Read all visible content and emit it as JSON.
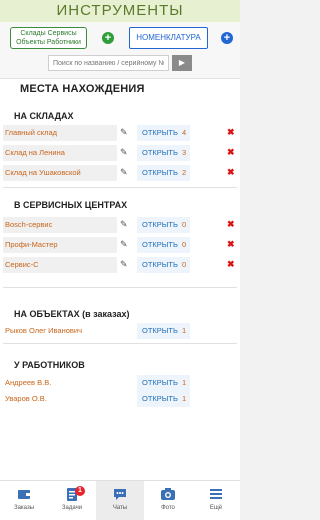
{
  "app": {
    "title": "ИНСТРУМЕНТЫ"
  },
  "toolbar": {
    "warehouses_button": [
      "Склады Сервисы",
      "Объекты Работники"
    ],
    "nomenclature_button": "НОМЕНКЛАТУРА",
    "search_placeholder": "Поиск по названию / серийному №"
  },
  "main": {
    "title": "МЕСТА НАХОЖДЕНИЯ",
    "open_label": "ОТКРЫТЬ",
    "sections": [
      {
        "title": "НА СКЛАДАХ",
        "items": [
          {
            "name": "Главный склад",
            "count": "4"
          },
          {
            "name": "Склад на Ленина",
            "count": "3"
          },
          {
            "name": "Склад на Ушаковской",
            "count": "2"
          }
        ]
      },
      {
        "title": "В СЕРВИСНЫХ ЦЕНТРАХ",
        "items": [
          {
            "name": "Bosch-сервис",
            "count": "0"
          },
          {
            "name": "Профи-Мастер",
            "count": "0"
          },
          {
            "name": "Сервис-С",
            "count": "0"
          }
        ]
      },
      {
        "title": "НА ОБЪЕКТАХ (в заказах)",
        "items": [
          {
            "name": "Рыков Олег Иванович",
            "count": "1"
          }
        ]
      },
      {
        "title": "У РАБОТНИКОВ",
        "items": [
          {
            "name": "Андреев В.В.",
            "count": "1"
          },
          {
            "name": "Уваров О.В.",
            "count": "1"
          }
        ]
      }
    ]
  },
  "tabbar": {
    "tabs": [
      {
        "label": "Заказы",
        "icon": "wallet-icon"
      },
      {
        "label": "Задачи",
        "icon": "clipboard-icon",
        "badge": "1"
      },
      {
        "label": "Чаты",
        "icon": "chat-icon",
        "active": true
      },
      {
        "label": "Фото",
        "icon": "camera-icon"
      },
      {
        "label": "Ещё",
        "icon": "menu-icon"
      }
    ]
  },
  "colors": {
    "accent_green": "#2e9d3a",
    "accent_blue": "#2266d4",
    "item_orange": "#c9651b",
    "link_blue": "#1f6fb8",
    "delete_red": "#dd1111",
    "badge_red": "#e8232b"
  }
}
